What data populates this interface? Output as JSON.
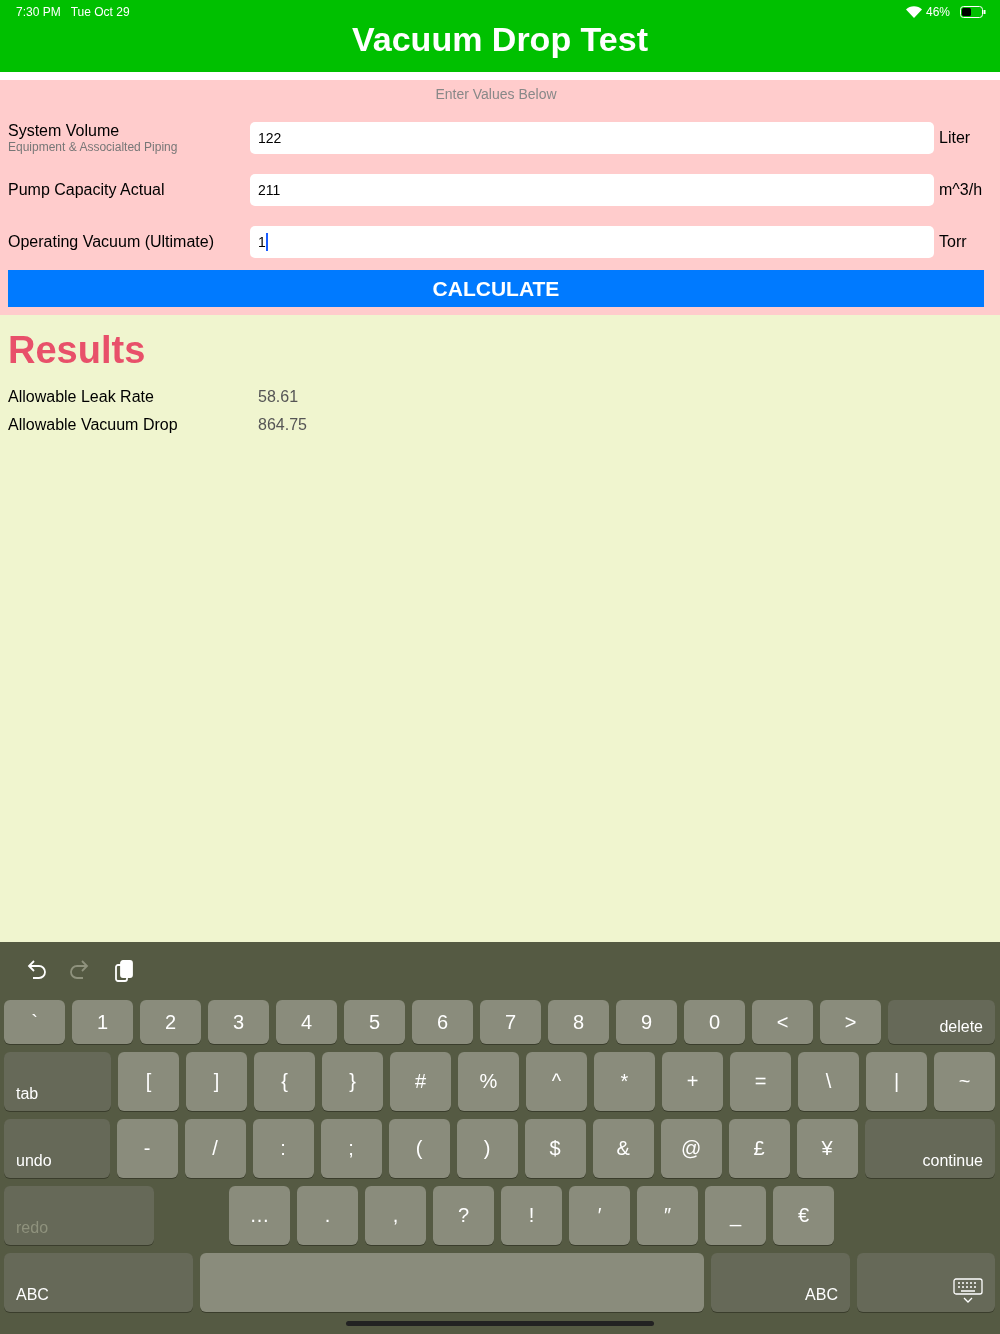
{
  "status_bar": {
    "time": "7:30 PM",
    "date": "Tue Oct 29",
    "battery": "46%"
  },
  "header": {
    "title": "Vacuum Drop Test"
  },
  "form": {
    "caption": "Enter Values Below",
    "fields": [
      {
        "label": "System Volume",
        "sublabel": "Equipment & Associalted Piping",
        "value": "122",
        "unit": "Liter",
        "focused": false
      },
      {
        "label": "Pump Capacity Actual",
        "value": "211",
        "unit": "m^3/h",
        "focused": false
      },
      {
        "label": "Operating Vacuum (Ultimate)",
        "value": "1",
        "unit": "Torr",
        "focused": true
      }
    ],
    "button": "CALCULATE"
  },
  "results": {
    "title": "Results",
    "rows": [
      {
        "label": "Allowable Leak Rate",
        "value": "58.61"
      },
      {
        "label": "Allowable Vacuum Drop",
        "value": "864.75"
      }
    ]
  },
  "keyboard": {
    "toolbar": [
      {
        "kind": "undo",
        "disabled": false
      },
      {
        "kind": "redo",
        "disabled": true
      },
      {
        "kind": "paste",
        "disabled": false
      }
    ],
    "rows": [
      {
        "keys": [
          {
            "kind": "char",
            "label": "`"
          },
          {
            "kind": "char",
            "label": "1"
          },
          {
            "kind": "char",
            "label": "2"
          },
          {
            "kind": "char",
            "label": "3"
          },
          {
            "kind": "char",
            "label": "4"
          },
          {
            "kind": "char",
            "label": "5"
          },
          {
            "kind": "char",
            "label": "6"
          },
          {
            "kind": "char",
            "label": "7"
          },
          {
            "kind": "char",
            "label": "8"
          },
          {
            "kind": "char",
            "label": "9"
          },
          {
            "kind": "char",
            "label": "0"
          },
          {
            "kind": "char",
            "label": "<"
          },
          {
            "kind": "char",
            "label": ">"
          },
          {
            "kind": "right",
            "label": "delete",
            "disabled": false
          }
        ]
      },
      {
        "keys": [
          {
            "kind": "left",
            "label": "tab",
            "disabled": false
          },
          {
            "kind": "char",
            "label": "["
          },
          {
            "kind": "char",
            "label": "]"
          },
          {
            "kind": "char",
            "label": "{"
          },
          {
            "kind": "char",
            "label": "}"
          },
          {
            "kind": "char",
            "label": "#"
          },
          {
            "kind": "char",
            "label": "%"
          },
          {
            "kind": "char",
            "label": "^"
          },
          {
            "kind": "char",
            "label": "*"
          },
          {
            "kind": "char",
            "label": "+"
          },
          {
            "kind": "char",
            "label": "="
          },
          {
            "kind": "char",
            "label": "\\"
          },
          {
            "kind": "char",
            "label": "|"
          },
          {
            "kind": "char",
            "label": "~"
          }
        ]
      },
      {
        "keys": [
          {
            "kind": "left",
            "label": "undo",
            "disabled": false
          },
          {
            "kind": "char",
            "label": "-"
          },
          {
            "kind": "char",
            "label": "/"
          },
          {
            "kind": "char",
            "label": ":"
          },
          {
            "kind": "char",
            "label": ";"
          },
          {
            "kind": "char",
            "label": "("
          },
          {
            "kind": "char",
            "label": ")"
          },
          {
            "kind": "char",
            "label": "$"
          },
          {
            "kind": "char",
            "label": "&"
          },
          {
            "kind": "char",
            "label": "@"
          },
          {
            "kind": "char",
            "label": "£"
          },
          {
            "kind": "char",
            "label": "¥"
          },
          {
            "kind": "right",
            "label": "continue",
            "disabled": false
          }
        ]
      },
      {
        "keys": [
          {
            "kind": "left",
            "label": "redo",
            "disabled": true
          },
          {
            "kind": "char",
            "label": "…"
          },
          {
            "kind": "char",
            "label": "."
          },
          {
            "kind": "char",
            "label": ","
          },
          {
            "kind": "char",
            "label": "?"
          },
          {
            "kind": "char",
            "label": "!"
          },
          {
            "kind": "char",
            "label": "′"
          },
          {
            "kind": "char",
            "label": "″"
          },
          {
            "kind": "char",
            "label": "_"
          },
          {
            "kind": "char",
            "label": "€"
          }
        ]
      },
      {
        "keys": [
          {
            "kind": "left",
            "label": "ABC",
            "disabled": false
          },
          {
            "kind": "space"
          },
          {
            "kind": "right",
            "label": "ABC",
            "disabled": false
          },
          {
            "kind": "dismiss"
          }
        ]
      }
    ]
  }
}
